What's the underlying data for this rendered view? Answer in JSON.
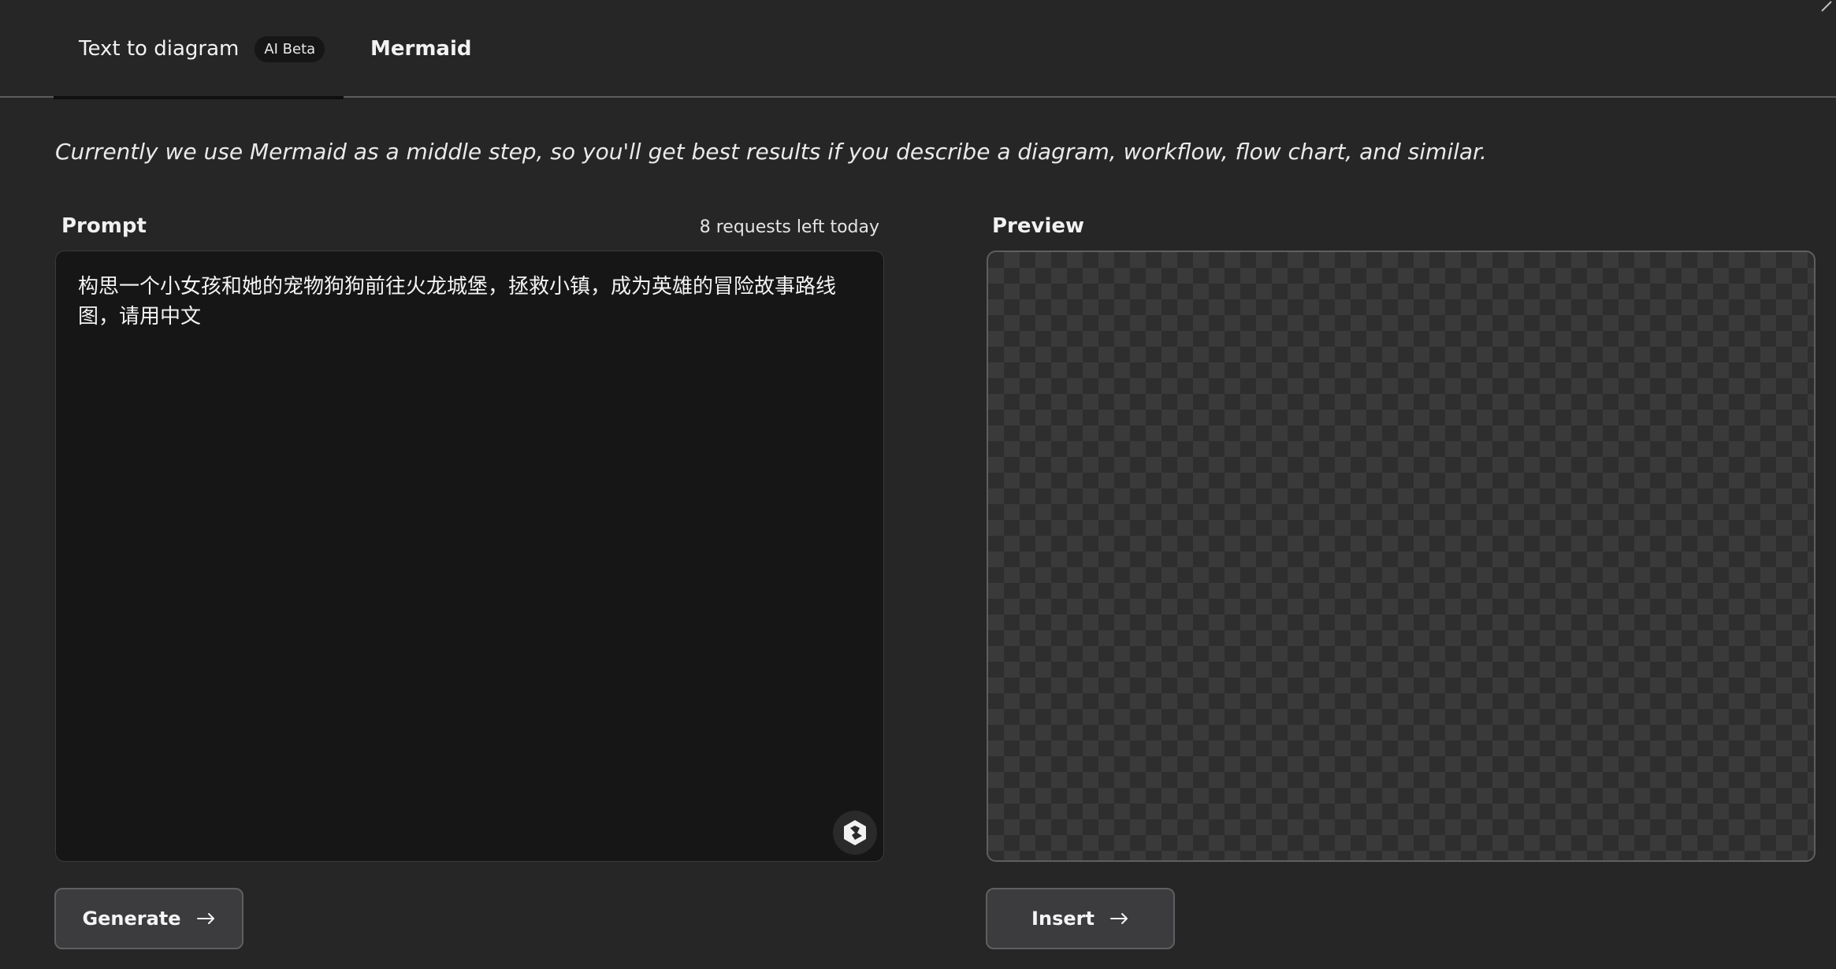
{
  "tabs": {
    "text_to_diagram": "Text to diagram",
    "beta_badge": "AI Beta",
    "mermaid": "Mermaid"
  },
  "description": "Currently we use Mermaid as a middle step, so you'll get best results if you describe a diagram, workflow, flow chart, and similar.",
  "prompt": {
    "label": "Prompt",
    "requests_left": "8 requests left today",
    "value": "构思一个小女孩和她的宠物狗狗前往火龙城堡，拯救小镇，成为英雄的冒险故事路线图，请用中文"
  },
  "preview": {
    "label": "Preview"
  },
  "buttons": {
    "generate": "Generate",
    "insert": "Insert"
  },
  "icons": {
    "arrow": "arrow-right-icon",
    "assist": "ai-assist-icon",
    "corner": "expand-icon"
  },
  "colors": {
    "background": "#262627",
    "prompt_bg": "#161616",
    "button_bg": "#3c3c3e"
  }
}
